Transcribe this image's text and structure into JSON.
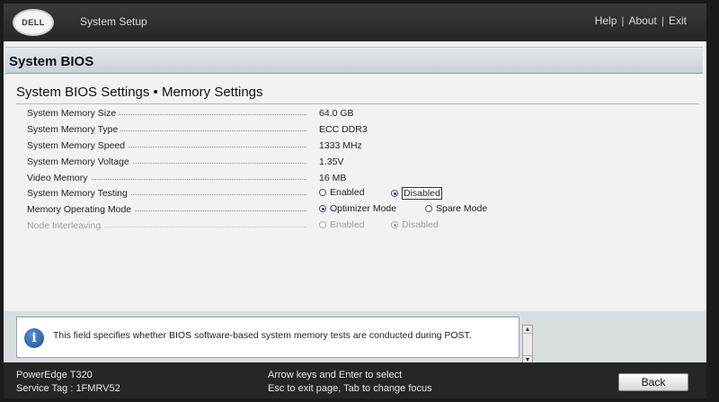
{
  "header": {
    "logo_text": "DELL",
    "app_title": "System Setup",
    "links": [
      "Help",
      "About",
      "Exit"
    ]
  },
  "section": {
    "title": "System BIOS"
  },
  "page": {
    "title": "System BIOS Settings • Memory Settings"
  },
  "settings": [
    {
      "label": "System Memory Size",
      "value": "64.0 GB"
    },
    {
      "label": "System Memory Type",
      "value": "ECC DDR3"
    },
    {
      "label": "System Memory Speed",
      "value": "1333 MHz"
    },
    {
      "label": "System Memory Voltage",
      "value": "1.35V"
    },
    {
      "label": "Video Memory",
      "value": "16 MB"
    },
    {
      "label": "System Memory Testing",
      "options": [
        "Enabled",
        "Disabled"
      ],
      "selected": "Disabled",
      "focused": "Disabled"
    },
    {
      "label": "Memory Operating Mode",
      "options": [
        "Optimizer Mode",
        "Spare Mode"
      ],
      "selected": "Optimizer Mode"
    },
    {
      "label": "Node Interleaving",
      "options": [
        "Enabled",
        "Disabled"
      ],
      "selected": "Disabled",
      "disabled": true
    }
  ],
  "help": {
    "icon": "info-icon",
    "text": "This field specifies whether BIOS software-based system memory tests are conducted during POST."
  },
  "footer": {
    "model": "PowerEdge T320",
    "service_tag": "Service Tag : 1FMRV52",
    "hint1": "Arrow keys and Enter to select",
    "hint2": "Esc to exit page, Tab to change focus",
    "back_label": "Back"
  }
}
